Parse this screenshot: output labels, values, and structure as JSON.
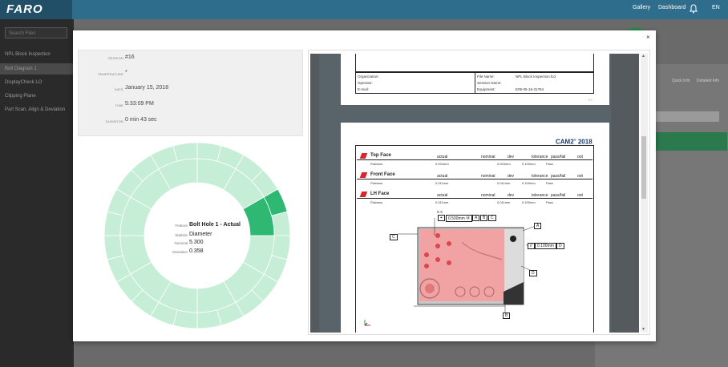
{
  "header": {
    "logo": "FARO",
    "nav": [
      "Gallery",
      "Dashboard"
    ],
    "lang": "EN",
    "bell_icon": "bell-icon"
  },
  "sidebar": {
    "search_placeholder": "Search Files",
    "items": [
      "NPL Block Inspection",
      "Bolt Diagram 1",
      "DisplayCheck LO",
      "Clipping Plane",
      "Part Scan, Align & Deviation"
    ]
  },
  "right_panel": {
    "tabs": [
      "Quick Info",
      "Detailed Info"
    ]
  },
  "modal": {
    "close": "×",
    "session": {
      "session_label": "SESSION",
      "session_value": "#16",
      "temperature_label": "TEMPERATURE",
      "temperature_value": "*",
      "date_label": "DATE",
      "date_value": "January 15, 2018",
      "time_label": "TIME",
      "time_value": "5:33:09 PM",
      "duration_label": "DURATION",
      "duration_value": "0 min 43 sec"
    },
    "donut": {
      "feature_label": "Feature",
      "feature_value": "Bolt Hole 1 - Actual",
      "statistic_label": "Statistic",
      "statistic_value": "Diameter",
      "nominal_label": "Nominal",
      "nominal_value": "5.300",
      "deviation_label": "Deviation",
      "deviation_value": "0.358",
      "light_color": "#c6eed7",
      "highlight_color": "#2eb872"
    },
    "report": {
      "page1": {
        "organization": "Organization:",
        "operator": "Operator:",
        "email": "E-mail:",
        "file_name_label": "File Name:",
        "file_name_value": "NPL Block Inspection.fcd",
        "session_name_label": "Session Name:",
        "equipment_label": "Equipment:",
        "equipment_value": "E09-05-16-31784",
        "page_num": "1/3"
      },
      "page2": {
        "brand": "CAM2",
        "brand_sup": "®",
        "year": " 2018",
        "columns": [
          "actual",
          "nominal",
          "dev",
          "tolerance",
          "pass/fail",
          "oot"
        ],
        "sections": [
          {
            "title": "Top Face",
            "row": [
              "Flatness",
              "0.024mm",
              "0.024mm",
              "0.100mm",
              "Pass"
            ]
          },
          {
            "title": "Front Face",
            "row": [
              "Flatness",
              "0.011mm",
              "0.011mm",
              "0.100mm",
              "Pass"
            ]
          },
          {
            "title": "LH Face",
            "row": [
              "Flatness",
              "0.011mm",
              "0.011mm",
              "0.100mm",
              "Pass"
            ]
          }
        ],
        "tol_count": "6-X",
        "tol_frame": [
          "⌖",
          "0.500mm Ⓜ",
          "A",
          "B",
          "C"
        ],
        "flat_frame": [
          "//",
          "0.100mm",
          "D"
        ],
        "datums": [
          "A",
          "B",
          "C",
          "D"
        ]
      }
    }
  }
}
